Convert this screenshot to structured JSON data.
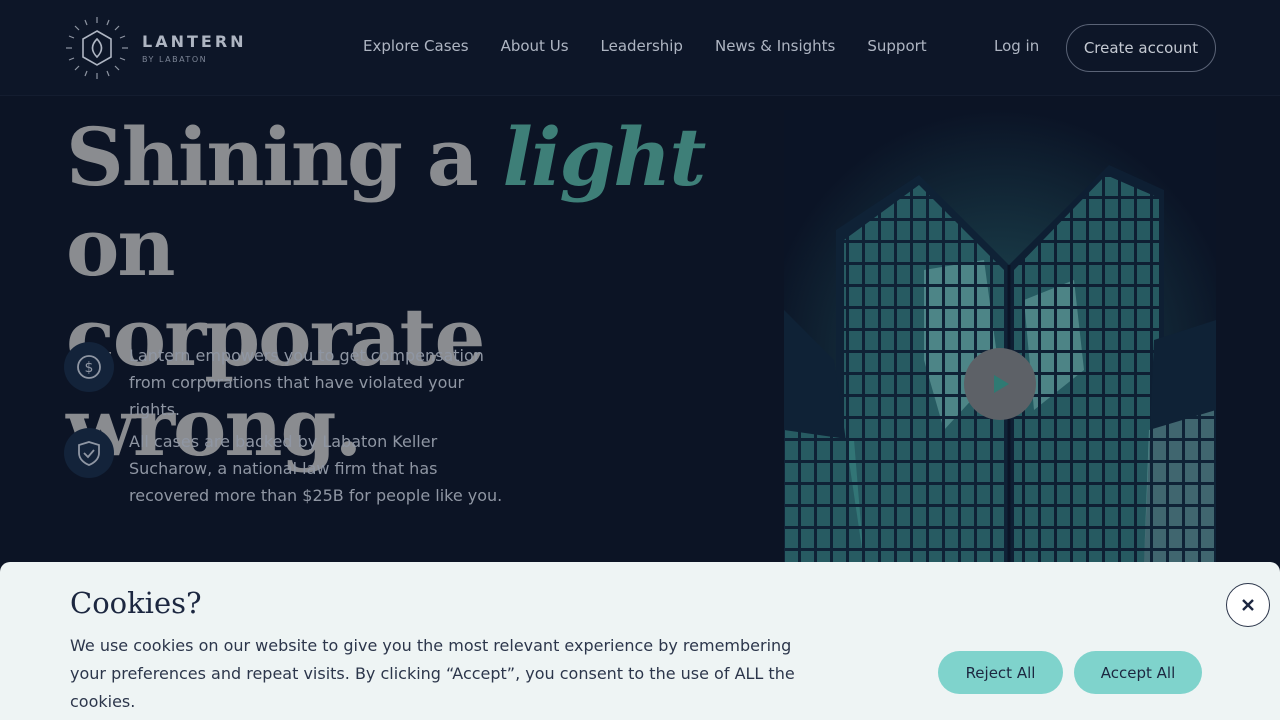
{
  "brand": {
    "name": "LANTERN",
    "sub": "BY LABATON",
    "logo_icon": "lantern-logo-icon"
  },
  "nav": {
    "items": [
      {
        "label": "Explore Cases"
      },
      {
        "label": "About Us"
      },
      {
        "label": "Leadership"
      },
      {
        "label": "News & Insights"
      },
      {
        "label": "Support"
      }
    ],
    "login": "Log in",
    "create_account": "Create account"
  },
  "hero": {
    "title_part1": "Shining a ",
    "title_accent": "light",
    "title_part2": " on",
    "title_line2": "corporate wrong.",
    "features": [
      {
        "icon": "dollar-icon",
        "text": "Lantern empowers you to get compensation from corporations that have violated your rights."
      },
      {
        "icon": "shield-check-icon",
        "text": "All cases are backed by Labaton Keller Sucharow, a national law firm that has recovered more than $25B for people like you."
      }
    ],
    "video_icon": "play-icon"
  },
  "cookie": {
    "title": "Cookies?",
    "text": "We use cookies on our website to give you the most relevant experience by remembering your preferences and repeat visits. By clicking “Accept”, you consent to the use of ALL the cookies.",
    "reject": "Reject All",
    "accept": "Accept All",
    "close_icon": "close-icon"
  },
  "colors": {
    "background": "#0c1425",
    "accent": "#3e7f78",
    "button_teal": "#7fd3cc",
    "banner": "#eef4f4"
  }
}
